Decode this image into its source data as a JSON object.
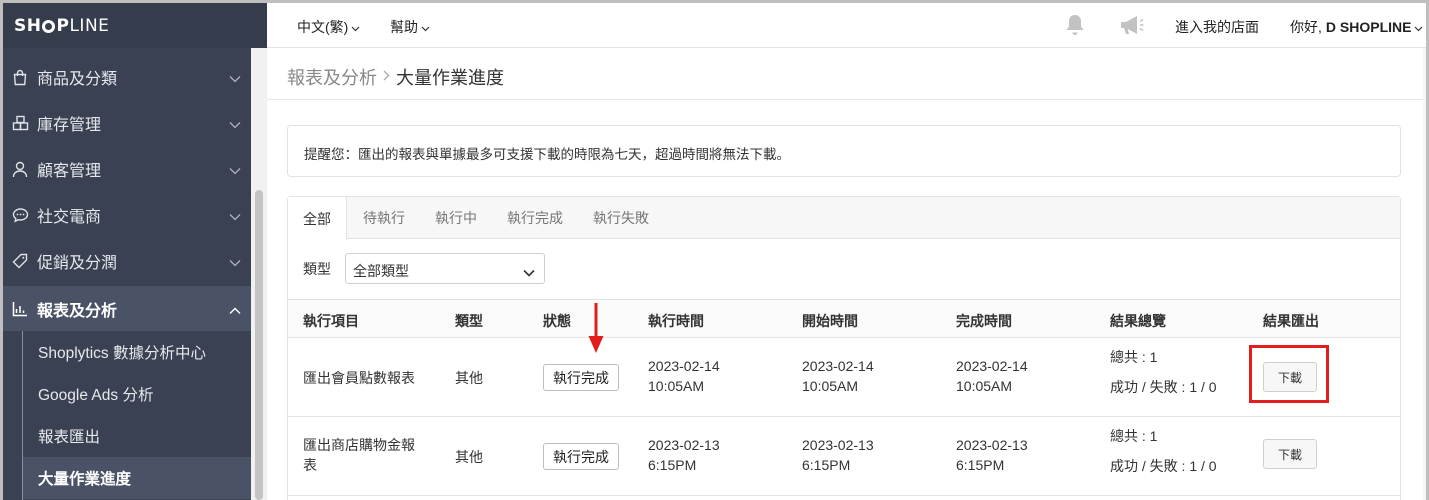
{
  "brand": {
    "logo_left": "SH",
    "logo_mid": "P",
    "logo_right": "LINE"
  },
  "sidebar": {
    "items": [
      {
        "label": "商品及分類",
        "icon": "bag-icon"
      },
      {
        "label": "庫存管理",
        "icon": "boxes-icon"
      },
      {
        "label": "顧客管理",
        "icon": "user-icon"
      },
      {
        "label": "社交電商",
        "icon": "chat-icon"
      },
      {
        "label": "促銷及分潤",
        "icon": "tag-icon"
      },
      {
        "label": "報表及分析",
        "icon": "chart-icon"
      }
    ],
    "subitems": [
      {
        "label": "Shoplytics 數據分析中心"
      },
      {
        "label": "Google Ads 分析"
      },
      {
        "label": "報表匯出"
      },
      {
        "label": "大量作業進度"
      }
    ]
  },
  "topbar": {
    "language": "中文(繁)",
    "help": "幫助",
    "visit_store": "進入我的店面",
    "greeting": "你好, ",
    "user_name": "D SHOPLINE"
  },
  "breadcrumb": {
    "parent": "報表及分析",
    "current": "大量作業進度"
  },
  "notice": "提醒您：匯出的報表與單據最多可支援下載的時限為七天，超過時間將無法下載。",
  "tabs": [
    "全部",
    "待執行",
    "執行中",
    "執行完成",
    "執行失敗"
  ],
  "filter": {
    "label": "類型",
    "selected": "全部類型"
  },
  "table": {
    "headers": [
      "執行項目",
      "類型",
      "狀態",
      "執行時間",
      "開始時間",
      "完成時間",
      "結果總覽",
      "結果匯出"
    ],
    "rows": [
      {
        "item_line1": "匯出會員點數報表",
        "item_line2": "",
        "type": "其他",
        "status": "執行完成",
        "exec_date": "2023-02-14",
        "exec_time": "10:05AM",
        "start_date": "2023-02-14",
        "start_time": "10:05AM",
        "end_date": "2023-02-14",
        "end_time": "10:05AM",
        "total": "總共 : 1",
        "result": "成功 / 失敗 : 1 / 0",
        "download": "下載"
      },
      {
        "item_line1": "匯出商店購物金報",
        "item_line2": "表",
        "type": "其他",
        "status": "執行完成",
        "exec_date": "2023-02-13",
        "exec_time": "6:15PM",
        "start_date": "2023-02-13",
        "start_time": "6:15PM",
        "end_date": "2023-02-13",
        "end_time": "6:15PM",
        "total": "總共 : 1",
        "result": "成功 / 失敗 : 1 / 0",
        "download": "下載"
      }
    ]
  },
  "colors": {
    "sidebar_bg": "#3a4152",
    "highlight_red": "#e11d1d"
  }
}
